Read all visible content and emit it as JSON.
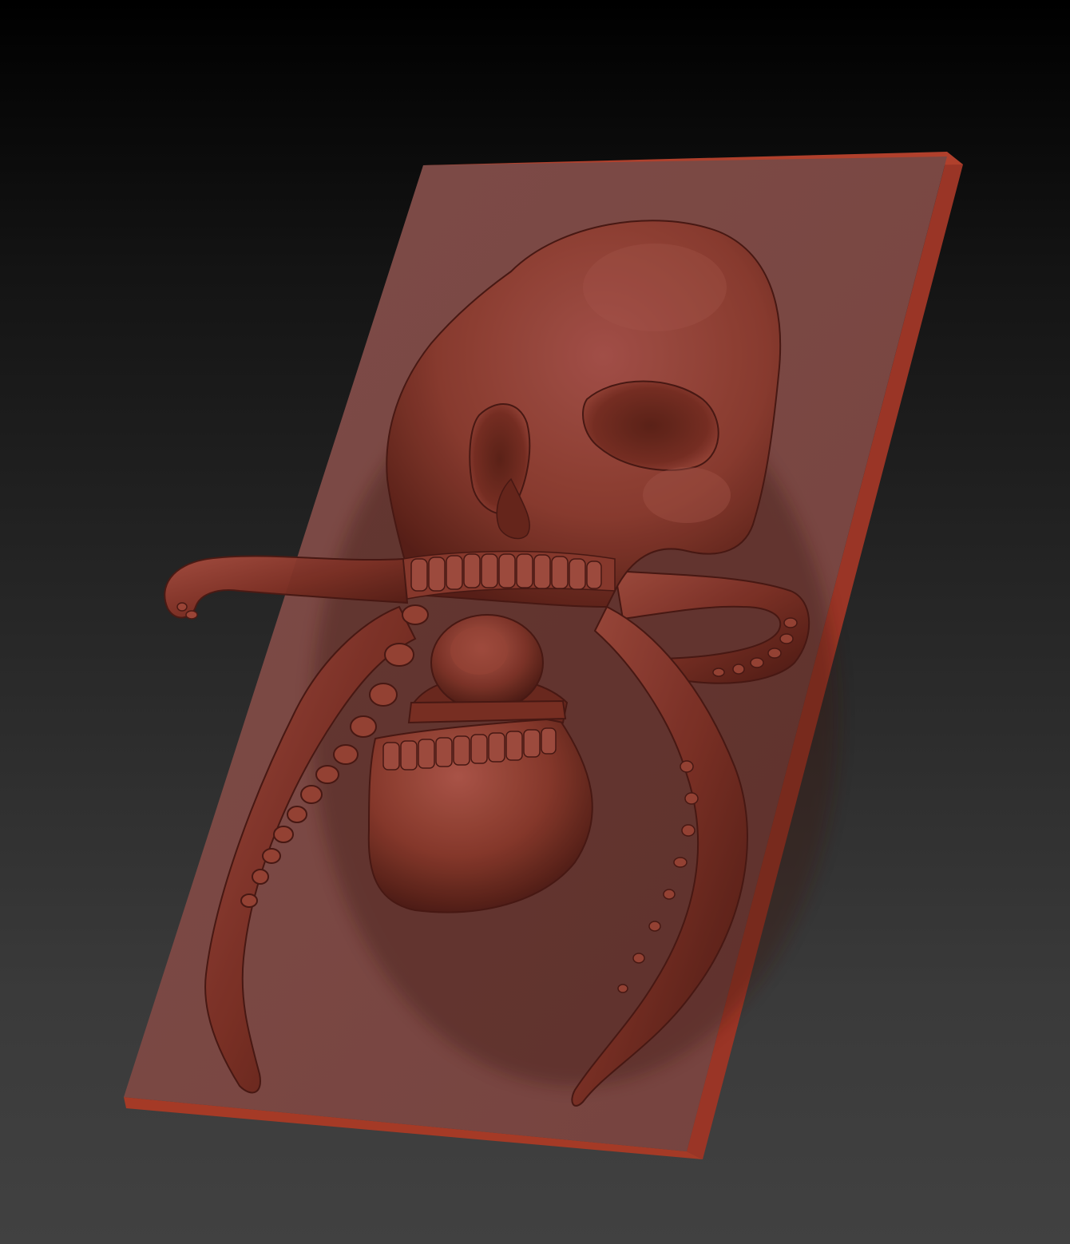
{
  "scene": {
    "subject": "skull-with-tentacles-relief",
    "colors": {
      "background_top": "#000000",
      "background_bottom": "#414141",
      "plate_face": "#814c48",
      "plate_edge": "#a53a26",
      "clay_base": "#8a3a2c",
      "clay_light": "#b0574a",
      "clay_dark": "#4a1a14"
    }
  }
}
